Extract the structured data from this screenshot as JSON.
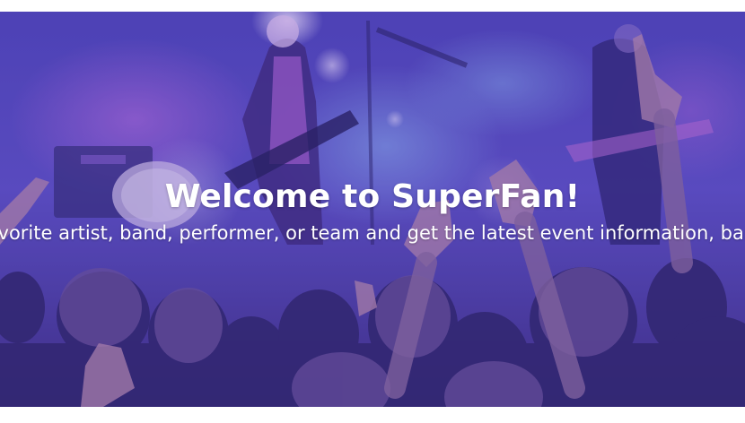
{
  "hero": {
    "title": "Welcome to SuperFan!",
    "subtitle": "Favorite artist, band, performer, or team and get the latest event information, band",
    "overlay_color": "#5a3fb0"
  }
}
